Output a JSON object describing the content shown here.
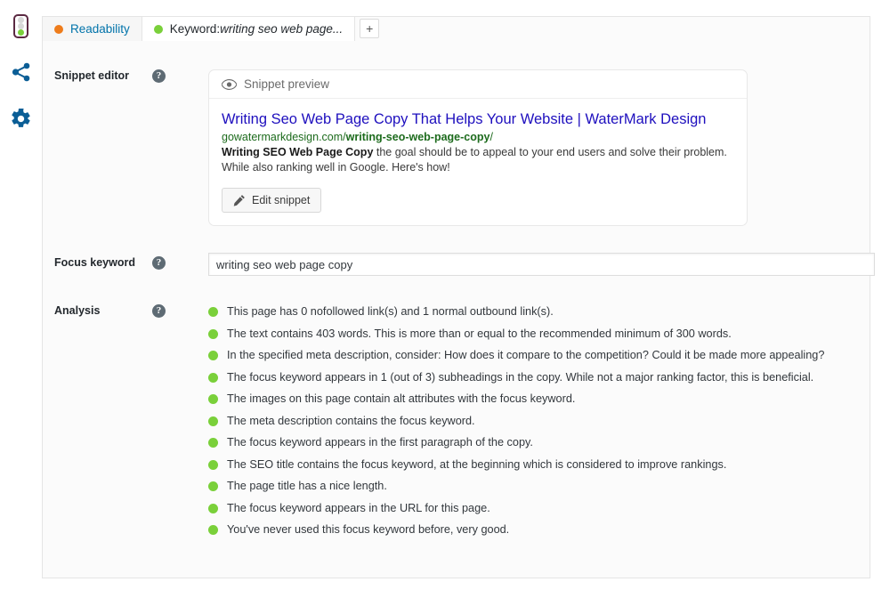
{
  "sidebar": {
    "items": [
      {
        "name": "seo-score-traffic-light",
        "icon": "traffic-light-icon",
        "state": "good"
      },
      {
        "name": "social-share",
        "icon": "share-icon"
      },
      {
        "name": "advanced-settings",
        "icon": "gear-icon"
      }
    ]
  },
  "tabs": {
    "items": [
      {
        "label": "Readability",
        "dot_color": "#ee7c1b",
        "active": false
      },
      {
        "label_prefix": "Keyword: ",
        "label_keyword": "writing seo web page...",
        "dot_color": "#7ad03a",
        "active": true
      }
    ],
    "add_label": "+"
  },
  "rows": {
    "snippet_editor_label": "Snippet editor",
    "focus_keyword_label": "Focus keyword",
    "analysis_label": "Analysis",
    "help_glyph": "?"
  },
  "snippet": {
    "preview_header": "Snippet preview",
    "title": "Writing Seo Web Page Copy That Helps Your Website | WaterMark Design",
    "url_domain": "gowatermarkdesign.com/",
    "url_slug": "writing-seo-web-page-copy",
    "url_trailing": "/",
    "description_bold": "Writing SEO Web Page Copy",
    "description_rest": " the goal should be to appeal to your end users and solve their problem. While also ranking well in Google. Here's how!",
    "edit_button_label": "Edit snippet"
  },
  "focus_keyword": {
    "value": "writing seo web page copy",
    "placeholder": "Focus keyword"
  },
  "analysis": {
    "good_color": "#7ad03a",
    "items": [
      {
        "score": "good",
        "text": "This page has 0 nofollowed link(s) and 1 normal outbound link(s)."
      },
      {
        "score": "good",
        "text": "The text contains 403 words. This is more than or equal to the recommended minimum of 300 words."
      },
      {
        "score": "good",
        "text": "In the specified meta description, consider: How does it compare to the competition? Could it be made more appealing?"
      },
      {
        "score": "good",
        "text": "The focus keyword appears in 1 (out of 3) subheadings in the copy. While not a major ranking factor, this is beneficial."
      },
      {
        "score": "good",
        "text": "The images on this page contain alt attributes with the focus keyword."
      },
      {
        "score": "good",
        "text": "The meta description contains the focus keyword."
      },
      {
        "score": "good",
        "text": "The focus keyword appears in the first paragraph of the copy."
      },
      {
        "score": "good",
        "text": "The SEO title contains the focus keyword, at the beginning which is considered to improve rankings."
      },
      {
        "score": "good",
        "text": "The page title has a nice length."
      },
      {
        "score": "good",
        "text": "The focus keyword appears in the URL for this page."
      },
      {
        "score": "good",
        "text": "You've never used this focus keyword before, very good."
      }
    ]
  }
}
